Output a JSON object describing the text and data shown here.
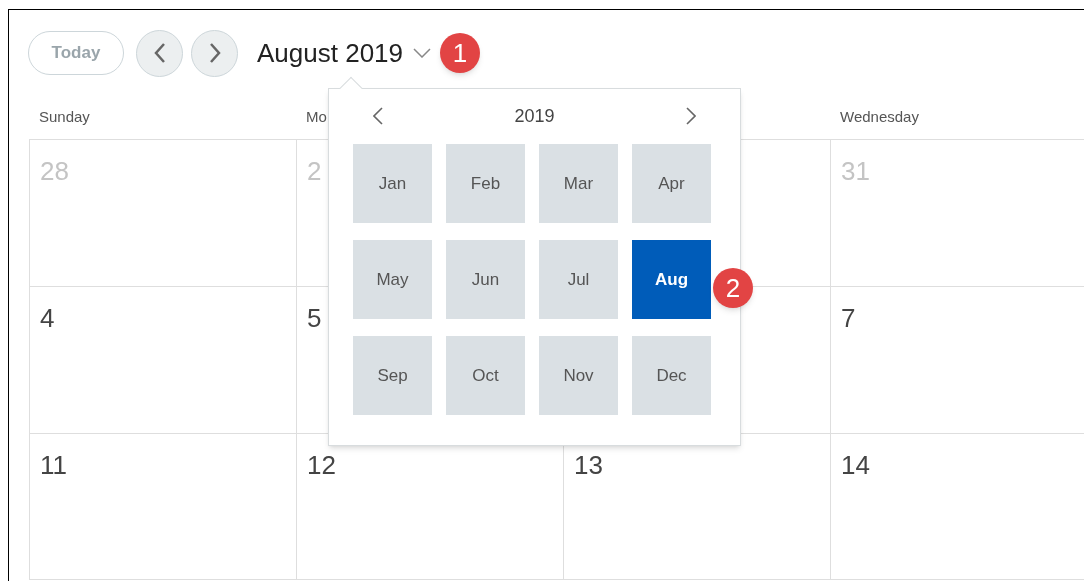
{
  "toolbar": {
    "today_button": "Today",
    "month_title": "August 2019",
    "callout": "1"
  },
  "columns": [
    {
      "header": "Sunday",
      "cells": [
        {
          "day": "28",
          "other_month": true
        },
        {
          "day": "4",
          "other_month": false
        },
        {
          "day": "11",
          "other_month": false
        }
      ]
    },
    {
      "header": "Mo",
      "cells": [
        {
          "day": "2",
          "other_month": true
        },
        {
          "day": "5",
          "other_month": false
        },
        {
          "day": "12",
          "other_month": false
        }
      ]
    },
    {
      "cells": [
        {},
        {},
        {
          "day": "13",
          "other_month": false
        }
      ]
    },
    {
      "header": "Wednesday",
      "cells": [
        {
          "day": "31",
          "other_month": true
        },
        {
          "day": "7",
          "other_month": false
        },
        {
          "day": "14",
          "other_month": false
        }
      ]
    }
  ],
  "month_picker": {
    "year": "2019",
    "callout": "2",
    "months": [
      {
        "label": "Jan",
        "selected": false
      },
      {
        "label": "Feb",
        "selected": false
      },
      {
        "label": "Mar",
        "selected": false
      },
      {
        "label": "Apr",
        "selected": false
      },
      {
        "label": "May",
        "selected": false
      },
      {
        "label": "Jun",
        "selected": false
      },
      {
        "label": "Jul",
        "selected": false
      },
      {
        "label": "Aug",
        "selected": true
      },
      {
        "label": "Sep",
        "selected": false
      },
      {
        "label": "Oct",
        "selected": false
      },
      {
        "label": "Nov",
        "selected": false
      },
      {
        "label": "Dec",
        "selected": false
      }
    ]
  }
}
